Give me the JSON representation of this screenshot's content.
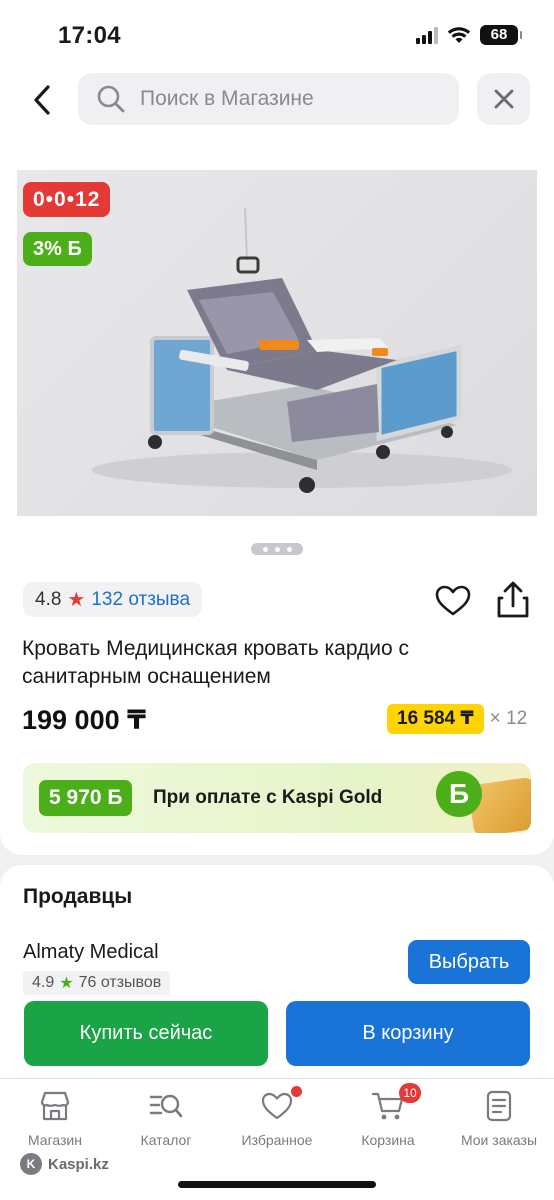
{
  "status_bar": {
    "time": "17:04",
    "battery": "68"
  },
  "search": {
    "placeholder": "Поиск в Магазине"
  },
  "product": {
    "timer_badge": "0•0•12",
    "bonus_badge": "3% Б",
    "rating": "4.8",
    "reviews": "132 отзыва",
    "title": "Кровать Медицинская кровать кардио с санитарным оснащением",
    "price": "199 000 ₸",
    "installment_amount": "16 584 ₸",
    "installment_months": "× 12",
    "image_pages": 3,
    "image_current_page": 1
  },
  "gold_banner": {
    "bonus": "5 970 Б",
    "text": "При оплате с Kaspi Gold",
    "coin": "Б"
  },
  "sellers": {
    "title": "Продавцы",
    "items": [
      {
        "name": "Almaty Medical",
        "rating": "4.9",
        "reviews": "76 отзывов",
        "button": "Выбрать"
      }
    ]
  },
  "actions": {
    "buy_now": "Купить сейчас",
    "add_to_cart": "В корзину"
  },
  "tabs": [
    {
      "label": "Магазин",
      "icon": "store-icon"
    },
    {
      "label": "Каталог",
      "icon": "catalog-search-icon"
    },
    {
      "label": "Избранное",
      "icon": "heart-icon",
      "dot": true
    },
    {
      "label": "Корзина",
      "icon": "cart-icon",
      "badge": "10"
    },
    {
      "label": "Мои заказы",
      "icon": "orders-icon"
    }
  ],
  "watermark": "Kaspi.kz",
  "colors": {
    "kaspi_red": "#e53935",
    "bonus_green": "#4caf1a",
    "primary_blue": "#1a73d6",
    "buy_green": "#1ba348",
    "installment_yellow": "#ffd400"
  }
}
